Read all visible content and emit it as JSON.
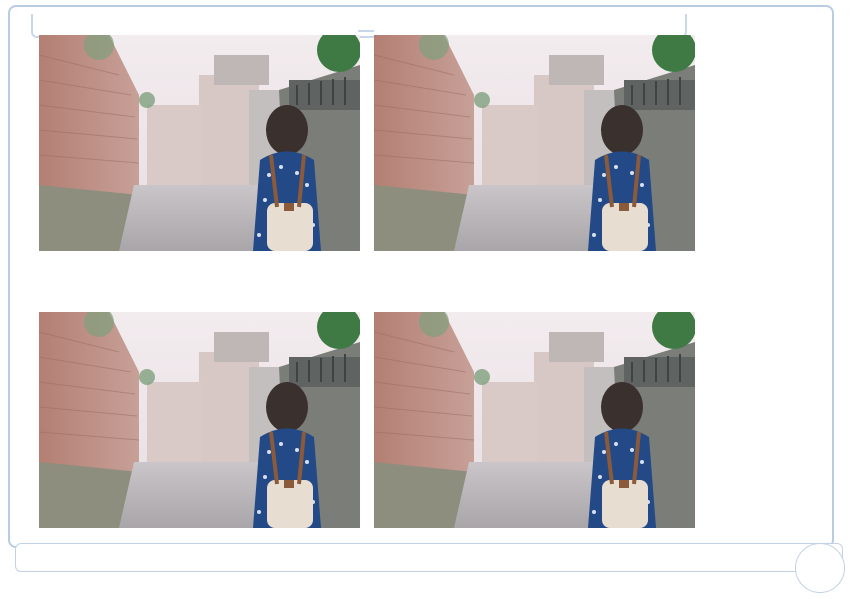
{
  "gallery": {
    "photos": [
      {
        "subject": "woman-in-alley-photo"
      },
      {
        "subject": "woman-in-alley-photo"
      },
      {
        "subject": "woman-in-alley-photo"
      },
      {
        "subject": "woman-in-alley-photo"
      }
    ]
  },
  "colors": {
    "panel_border": "#b9cce3",
    "bar_border": "#c2d2e6"
  }
}
